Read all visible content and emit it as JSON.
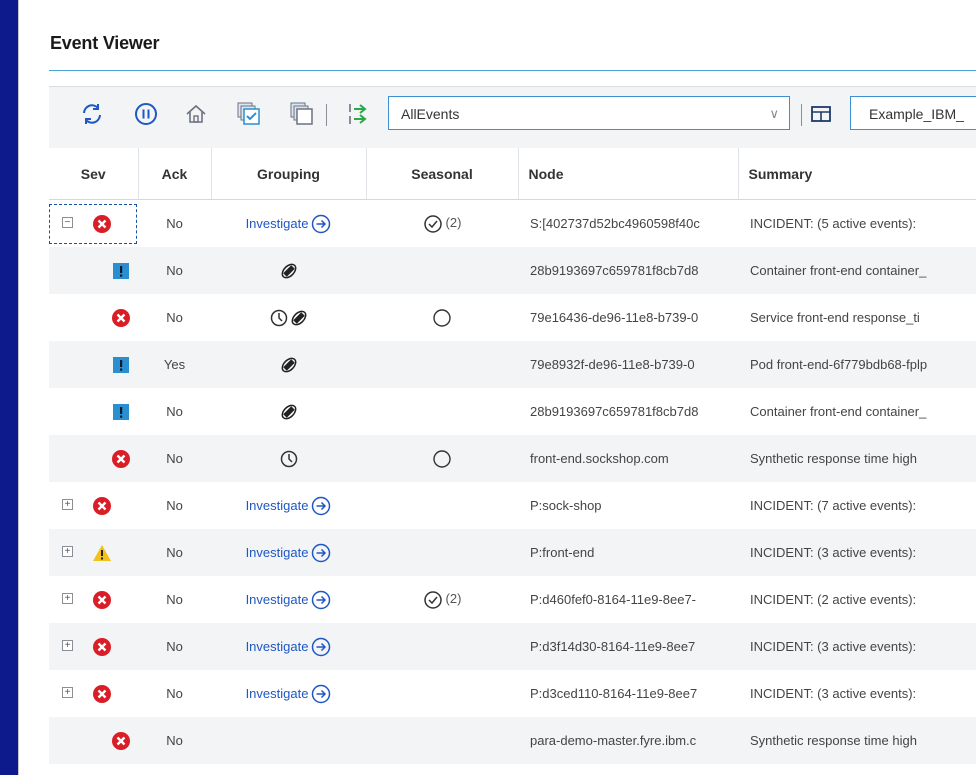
{
  "header": {
    "title": "Event Viewer"
  },
  "toolbar": {
    "filter_value": "AllEvents",
    "view_value": "Example_IBM_"
  },
  "columns": [
    "Sev",
    "Ack",
    "Grouping",
    "Seasonal",
    "Node",
    "Summary"
  ],
  "rows": [
    {
      "expander": "minus",
      "severity": "critical",
      "ack": "No",
      "grouping": "investigate",
      "grouping_label": "Investigate",
      "seasonal": "check",
      "seasonal_count": "(2)",
      "node": "S:[402737d52bc4960598f40c",
      "summary": "INCIDENT: (5 active events):"
    },
    {
      "expander": "",
      "severity": "minor",
      "ack": "No",
      "grouping": "related",
      "grouping_label": "",
      "seasonal": "",
      "seasonal_count": "",
      "node": "28b9193697c659781f8cb7d8",
      "summary": "Container front-end container_"
    },
    {
      "expander": "",
      "severity": "critical",
      "ack": "No",
      "grouping": "clock-related",
      "grouping_label": "",
      "seasonal": "circle",
      "seasonal_count": "",
      "node": "79e16436-de96-11e8-b739-0",
      "summary": "Service front-end response_ti"
    },
    {
      "expander": "",
      "severity": "minor",
      "ack": "Yes",
      "grouping": "related",
      "grouping_label": "",
      "seasonal": "",
      "seasonal_count": "",
      "node": "79e8932f-de96-11e8-b739-0",
      "summary": "Pod front-end-6f779bdb68-fplp"
    },
    {
      "expander": "",
      "severity": "minor",
      "ack": "No",
      "grouping": "related",
      "grouping_label": "",
      "seasonal": "",
      "seasonal_count": "",
      "node": "28b9193697c659781f8cb7d8",
      "summary": "Container front-end container_"
    },
    {
      "expander": "",
      "severity": "critical",
      "ack": "No",
      "grouping": "clock",
      "grouping_label": "",
      "seasonal": "circle",
      "seasonal_count": "",
      "node": "front-end.sockshop.com",
      "summary": "Synthetic response time high"
    },
    {
      "expander": "plus",
      "severity": "critical",
      "ack": "No",
      "grouping": "investigate",
      "grouping_label": "Investigate",
      "seasonal": "",
      "seasonal_count": "",
      "node": "P:sock-shop",
      "summary": "INCIDENT: (7 active events):"
    },
    {
      "expander": "plus",
      "severity": "warning",
      "ack": "No",
      "grouping": "investigate",
      "grouping_label": "Investigate",
      "seasonal": "",
      "seasonal_count": "",
      "node": "P:front-end",
      "summary": "INCIDENT: (3 active events):"
    },
    {
      "expander": "plus",
      "severity": "critical",
      "ack": "No",
      "grouping": "investigate",
      "grouping_label": "Investigate",
      "seasonal": "check",
      "seasonal_count": "(2)",
      "node": "P:d460fef0-8164-11e9-8ee7-",
      "summary": "INCIDENT: (2 active events):"
    },
    {
      "expander": "plus",
      "severity": "critical",
      "ack": "No",
      "grouping": "investigate",
      "grouping_label": "Investigate",
      "seasonal": "",
      "seasonal_count": "",
      "node": "P:d3f14d30-8164-11e9-8ee7",
      "summary": "INCIDENT: (3 active events):"
    },
    {
      "expander": "plus",
      "severity": "critical",
      "ack": "No",
      "grouping": "investigate",
      "grouping_label": "Investigate",
      "seasonal": "",
      "seasonal_count": "",
      "node": "P:d3ced110-8164-11e9-8ee7",
      "summary": "INCIDENT: (3 active events):"
    },
    {
      "expander": "",
      "severity": "critical",
      "ack": "No",
      "grouping": "",
      "grouping_label": "",
      "seasonal": "",
      "seasonal_count": "",
      "node": "para-demo-master.fyre.ibm.c",
      "summary": "Synthetic response time high"
    }
  ],
  "colors": {
    "critical": "#da1e28",
    "minor": "#2a8fd0",
    "warning": "#f1c21b",
    "link": "#1f57c3",
    "accent": "#3d8fd1"
  }
}
